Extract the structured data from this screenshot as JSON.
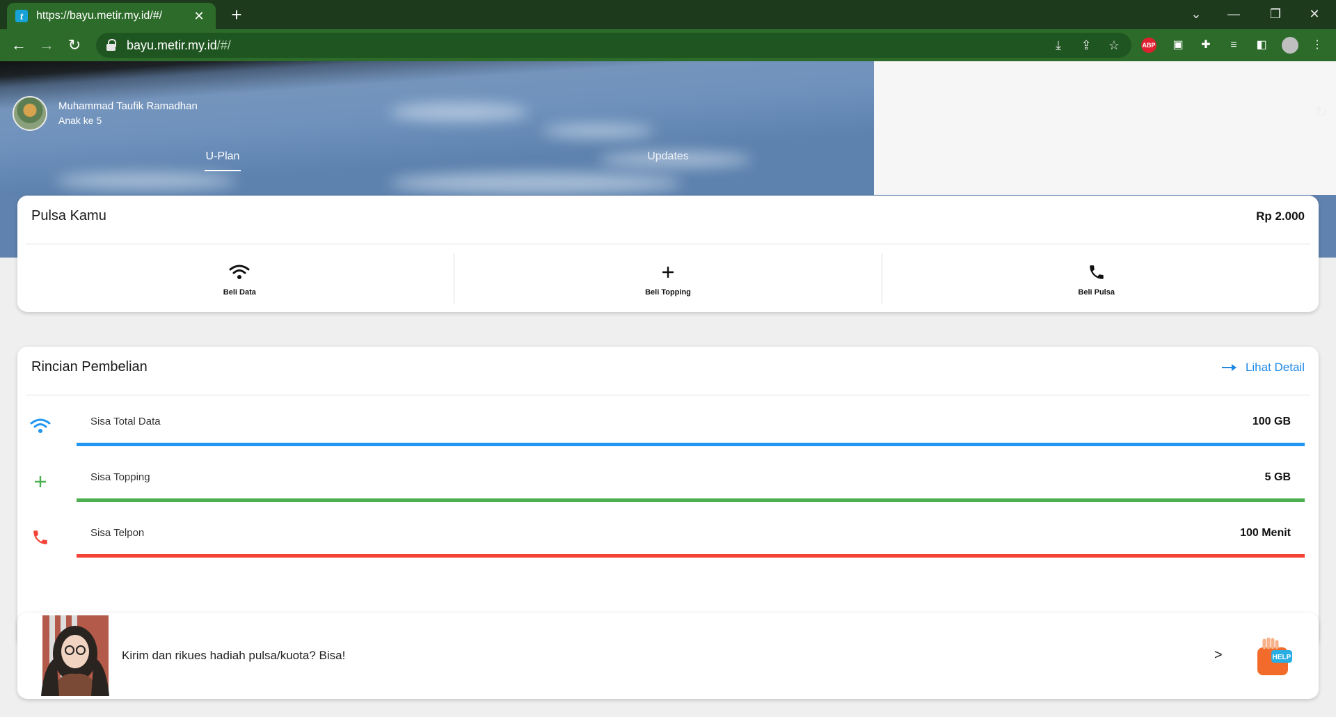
{
  "browser": {
    "tab_title": "https://bayu.metir.my.id/#/",
    "tab_favicon": "telkom-logo",
    "url_host": "bayu.metir.my.id",
    "url_path": "/#/",
    "extensions": [
      "abp-icon",
      "reader-icon",
      "puzzle-icon",
      "playlist-icon",
      "sidepanel-icon",
      "profile-avatar"
    ],
    "abp_label": "ABP",
    "accent": "#2c6b2a"
  },
  "header": {
    "user_name": "Muhammad Taufik Ramadhan",
    "user_subtitle": "Anak ke 5",
    "tabs": [
      {
        "label": "U-Plan",
        "active": true
      },
      {
        "label": "Updates",
        "active": false
      }
    ]
  },
  "pulsa": {
    "title": "Pulsa Kamu",
    "amount": "Rp 2.000",
    "actions": [
      {
        "label": "Beli Data",
        "icon": "wifi-icon"
      },
      {
        "label": "Beli Topping",
        "icon": "plus-icon"
      },
      {
        "label": "Beli Pulsa",
        "icon": "phone-icon"
      }
    ]
  },
  "rincian": {
    "title": "Rincian Pembelian",
    "detail_link": "Lihat Detail",
    "rows": [
      {
        "label": "Sisa Total Data",
        "value": "100 GB",
        "color": "#2196f3",
        "icon": "wifi-icon",
        "fill": 1.0
      },
      {
        "label": "Sisa Topping",
        "value": "5 GB",
        "color": "#4caf50",
        "icon": "plus-icon",
        "fill": 1.0
      },
      {
        "label": "Sisa Telpon",
        "value": "100 Menit",
        "color": "#f44336",
        "icon": "phone-icon",
        "fill": 1.0
      }
    ]
  },
  "promo": {
    "text": "Kirim dan rikues hadiah pulsa/kuota? Bisa!",
    "chevron": ">",
    "help_label": "HELP"
  }
}
